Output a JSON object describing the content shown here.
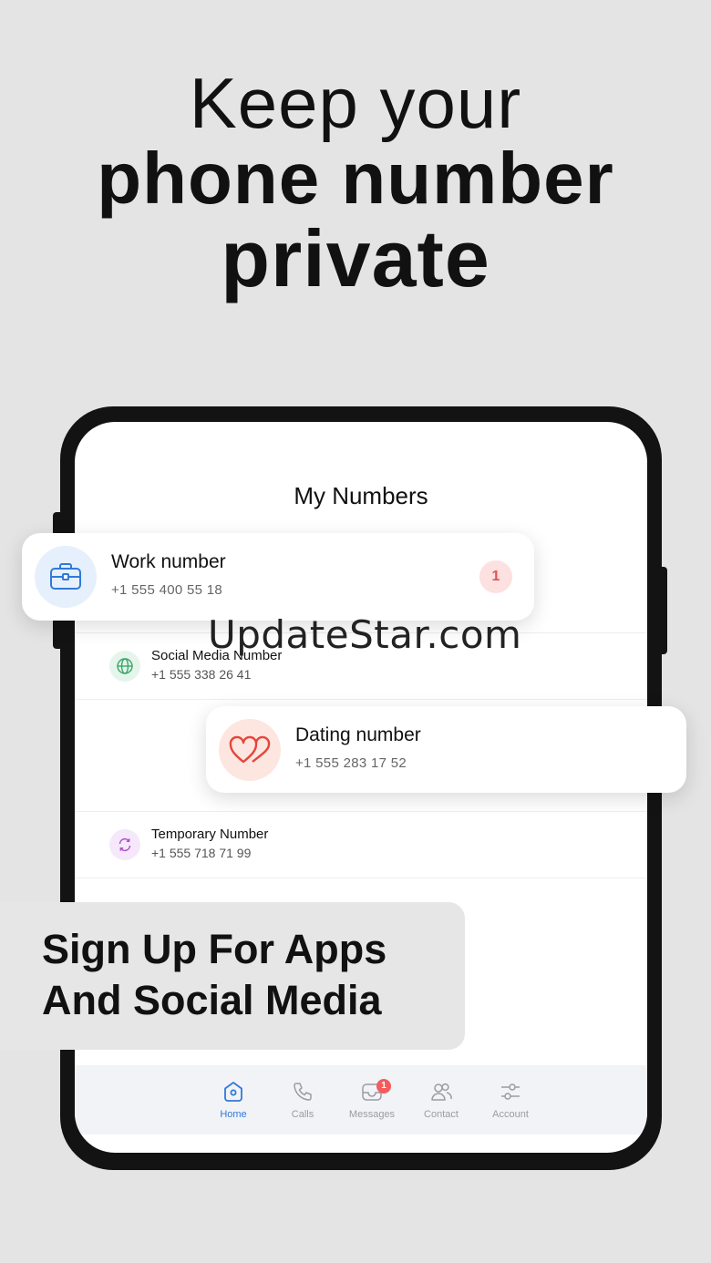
{
  "headline": {
    "line1": "Keep your",
    "line2": "phone number",
    "line3": "private"
  },
  "screen": {
    "title": "My Numbers",
    "rows": [
      {
        "name": "Social Media Number",
        "number": "+1 555 338 26 41",
        "icon": "globe-icon"
      },
      {
        "name": "Temporary Number",
        "number": "+1 555 718 71 99",
        "icon": "refresh-icon"
      }
    ]
  },
  "cards": {
    "work": {
      "name": "Work number",
      "number": "+1 555 400 55 18",
      "badge": "1",
      "icon": "briefcase-icon"
    },
    "dating": {
      "name": "Dating number",
      "number": "+1 555 283 17 52",
      "icon": "hearts-icon"
    }
  },
  "watermark": "UpdateStar.com",
  "promo": {
    "line1": "Sign Up For Apps",
    "line2": "And Social Media"
  },
  "tabbar": {
    "tabs": [
      {
        "label": "Home",
        "icon": "home-icon",
        "active": true
      },
      {
        "label": "Calls",
        "icon": "phone-icon"
      },
      {
        "label": "Messages",
        "icon": "inbox-icon",
        "badge": "1"
      },
      {
        "label": "Contact",
        "icon": "contacts-icon"
      },
      {
        "label": "Account",
        "icon": "sliders-icon"
      }
    ]
  },
  "colors": {
    "background": "#e4e4e4",
    "accent": "#2f7ad8",
    "badge": "#f25c5c",
    "phone_frame": "#131313"
  }
}
